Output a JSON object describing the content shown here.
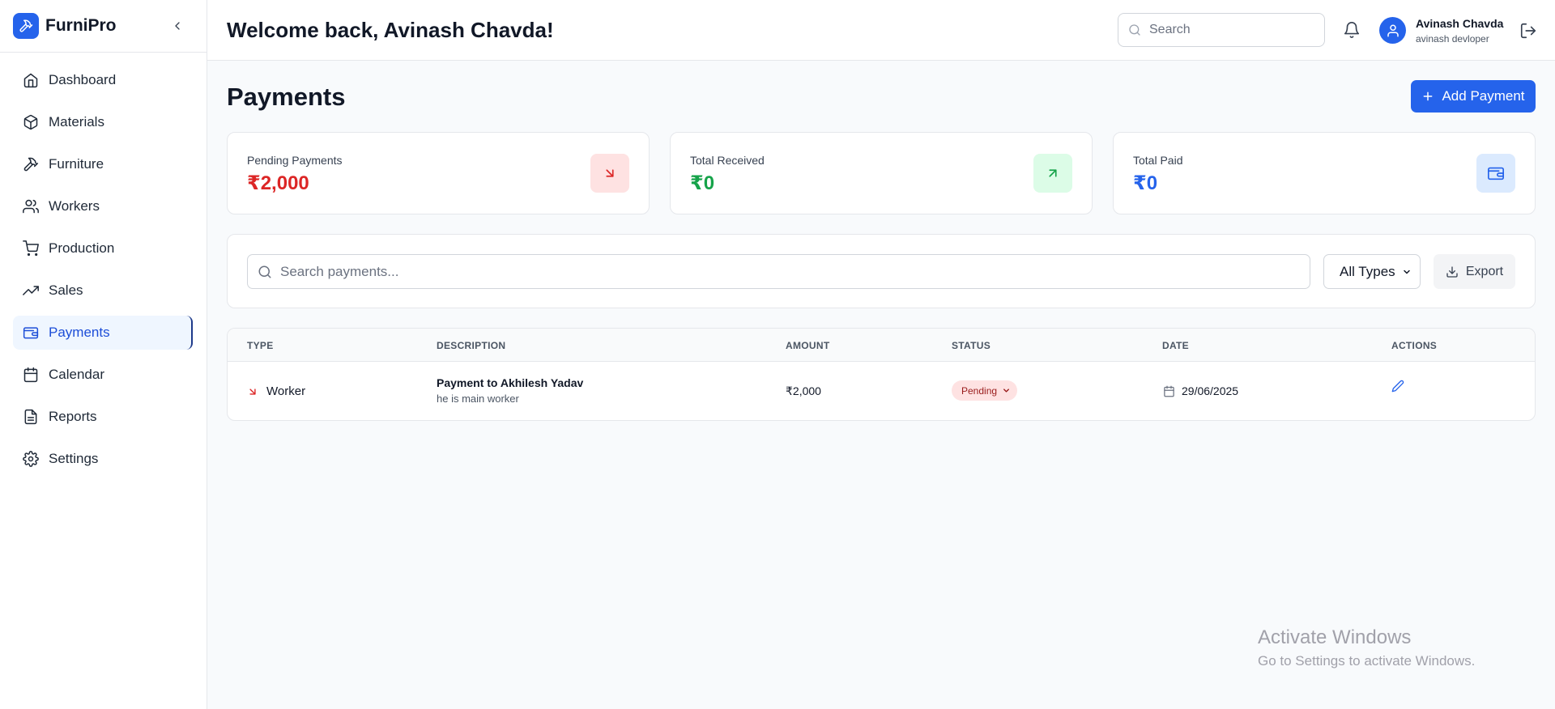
{
  "brand": {
    "name": "FurniPro"
  },
  "sidebar": {
    "items": [
      {
        "label": "Dashboard",
        "icon": "home-icon",
        "active": false
      },
      {
        "label": "Materials",
        "icon": "box-icon",
        "active": false
      },
      {
        "label": "Furniture",
        "icon": "hammer-icon",
        "active": false
      },
      {
        "label": "Workers",
        "icon": "users-icon",
        "active": false
      },
      {
        "label": "Production",
        "icon": "cart-icon",
        "active": false
      },
      {
        "label": "Sales",
        "icon": "trending-up-icon",
        "active": false
      },
      {
        "label": "Payments",
        "icon": "wallet-icon",
        "active": true
      },
      {
        "label": "Calendar",
        "icon": "calendar-icon",
        "active": false
      },
      {
        "label": "Reports",
        "icon": "file-text-icon",
        "active": false
      },
      {
        "label": "Settings",
        "icon": "gear-icon",
        "active": false
      }
    ]
  },
  "header": {
    "welcome": "Welcome back, Avinash Chavda!",
    "search_placeholder": "Search",
    "user": {
      "name": "Avinash Chavda",
      "role": "avinash devloper"
    }
  },
  "page": {
    "title": "Payments",
    "add_button": "Add Payment"
  },
  "stats": [
    {
      "label": "Pending Payments",
      "value": "₹2,000",
      "color": "#dc2626",
      "icon_bg": "#fee2e2",
      "icon": "arrow-down-right-icon"
    },
    {
      "label": "Total Received",
      "value": "₹0",
      "color": "#16a34a",
      "icon_bg": "#dcfce7",
      "icon": "arrow-up-right-icon"
    },
    {
      "label": "Total Paid",
      "value": "₹0",
      "color": "#2563eb",
      "icon_bg": "#dbeafe",
      "icon": "wallet-icon"
    }
  ],
  "filters": {
    "search_placeholder": "Search payments...",
    "type_selected": "All Types",
    "export_label": "Export"
  },
  "table": {
    "columns": [
      "TYPE",
      "DESCRIPTION",
      "AMOUNT",
      "STATUS",
      "DATE",
      "ACTIONS"
    ],
    "rows": [
      {
        "type": "Worker",
        "description_title": "Payment to Akhilesh Yadav",
        "description_note": "he is main worker",
        "amount": "₹2,000",
        "status": "Pending",
        "date": "29/06/2025"
      }
    ]
  },
  "watermark": {
    "title": "Activate Windows",
    "subtitle": "Go to Settings to activate Windows."
  },
  "colors": {
    "accent": "#2563eb",
    "pending_bg": "#fee2e2",
    "pending_text": "#991b1b"
  }
}
